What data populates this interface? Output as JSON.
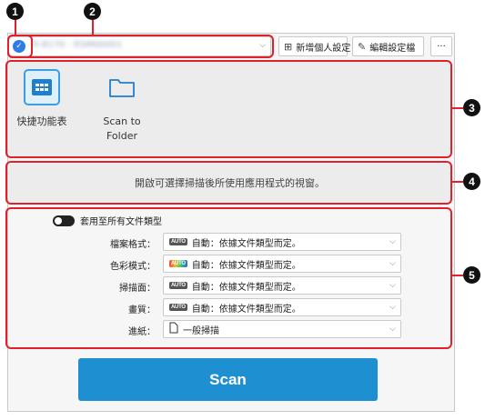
{
  "callouts": [
    "1",
    "2",
    "3",
    "4",
    "5"
  ],
  "profile": {
    "name": "fi-8170 - ESM00001",
    "checked": true
  },
  "toolbar": {
    "new_profile_label": "新增個人設定",
    "edit_profile_label": "編輯設定檔",
    "more_label": "···"
  },
  "apps": [
    {
      "label": "快捷功能表",
      "icon": "quick-menu-icon",
      "selected": true
    },
    {
      "label": "Scan to\nFolder",
      "icon": "folder-icon",
      "selected": false
    }
  ],
  "info_text": "開啟可選擇掃描後所使用應用程式的視窗。",
  "apply_all": {
    "label": "套用至所有文件類型"
  },
  "settings": [
    {
      "label": "檔案格式：",
      "badge": "AUTO",
      "value": "自動：依據文件類型而定。"
    },
    {
      "label": "色彩模式：",
      "badge": "AUTO",
      "value": "自動：依據文件類型而定。"
    },
    {
      "label": "掃描面：",
      "badge": "AUTO",
      "value": "自動：依據文件類型而定。"
    },
    {
      "label": "畫質：",
      "badge": "AUTO",
      "value": "自動：依據文件類型而定。"
    },
    {
      "label": "進紙：",
      "badge": "page-icon",
      "value": "一般掃描"
    }
  ],
  "scan_label": "Scan",
  "colors": {
    "accent": "#1e8fd1",
    "callout_box": "#e0202a",
    "selected_app": "#3aa0e6"
  }
}
